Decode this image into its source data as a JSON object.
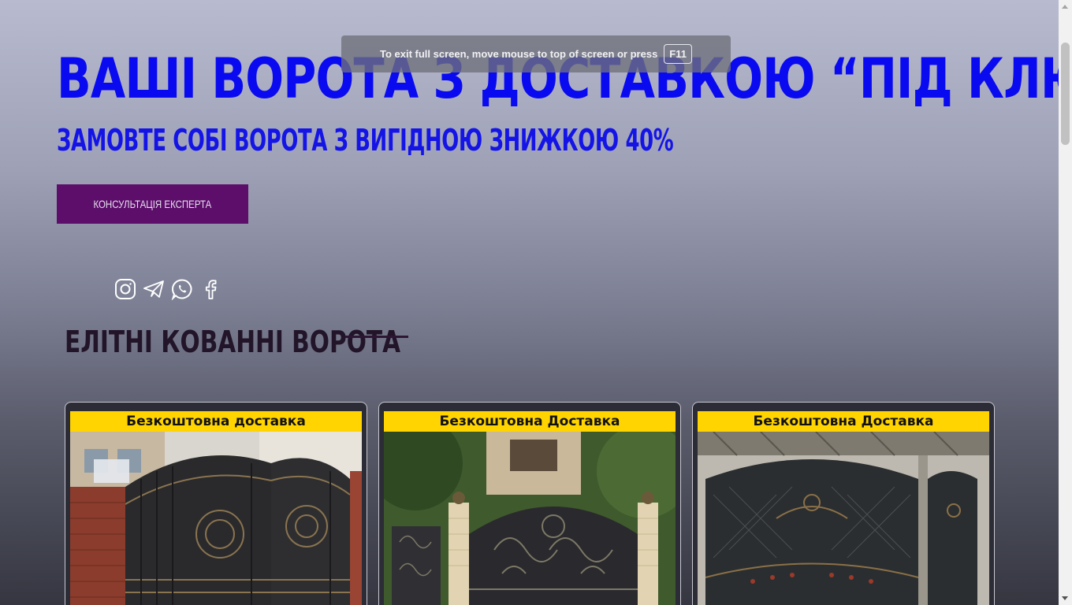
{
  "hero": {
    "title": "ВАШІ ВОРОТА З ДОСТАВКОЮ “ПІД КЛЮЧ”",
    "subtitle": "ЗАМОВТЕ СОБІ ВОРОТА З ВИГІДНОЮ ЗНИЖКОЮ 40%",
    "cta_label": "КОНСУЛЬТАЦІЯ ЕКСПЕРТА"
  },
  "social": {
    "icons": [
      "instagram-icon",
      "telegram-icon",
      "whatsapp-icon",
      "facebook-icon"
    ]
  },
  "section": {
    "title": "ЕЛІТНІ КОВАННІ ВОРОТА"
  },
  "products": [
    {
      "banner": "Безкоштовна доставка"
    },
    {
      "banner": "Безкоштовна Доставка"
    },
    {
      "banner": "Безкоштовна Доставка"
    }
  ],
  "fullscreen_notice": {
    "text": "To exit full screen, move mouse to top of screen or press",
    "key": "F11"
  },
  "colors": {
    "title": "#0a0af0",
    "button": "#5c0e6a",
    "banner": "#ffd400"
  }
}
